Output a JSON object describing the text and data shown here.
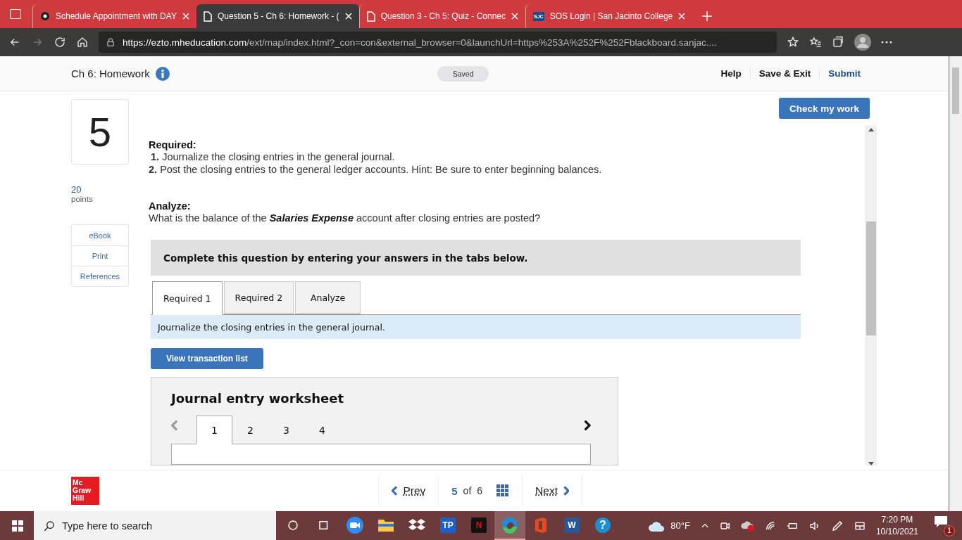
{
  "browser": {
    "tabs": [
      {
        "kind": "app",
        "label": "Schedule Appointment with DAY",
        "selected": false
      },
      {
        "kind": "doc",
        "label": "Question 5 - Ch 6: Homework - (",
        "selected": true
      },
      {
        "kind": "doc",
        "label": "Question 3 - Ch 5: Quiz - Connec",
        "selected": false
      },
      {
        "kind": "sjc",
        "badge": "SJC",
        "label": "SOS Login | San Jacinto College",
        "selected": false
      }
    ],
    "url_host": "https://ezto.mheducation.com",
    "url_path": "/ext/map/index.html?_con=con&external_browser=0&launchUrl=https%253A%252F%252Fblackboard.sanjac...."
  },
  "header": {
    "title": "Ch 6: Homework",
    "status": "Saved",
    "links": [
      "Help",
      "Save & Exit",
      "Submit"
    ]
  },
  "question": {
    "number": "5",
    "points": "20",
    "points_label": "points",
    "tools": [
      "eBook",
      "Print",
      "References"
    ]
  },
  "check_button": "Check my work",
  "required_heading": "Required:",
  "required_items": [
    {
      "num": "1.",
      "text": "Journalize the closing entries in the general journal."
    },
    {
      "num": "2.",
      "text": "Post the closing entries to the general ledger accounts. Hint: Be sure to enter beginning balances."
    }
  ],
  "analyze_heading": "Analyze:",
  "analyze_text": "What is the balance of the **Salaries Expense** account after closing entries are posted?",
  "instruction_banner": "Complete this question by entering your answers in the tabs below.",
  "answer_tabs": [
    {
      "label": "Required 1",
      "selected": true
    },
    {
      "label": "Required 2",
      "selected": false
    },
    {
      "label": "Analyze",
      "selected": false
    }
  ],
  "tab_instruction": "Journalize the closing entries in the general journal.",
  "view_button": "View transaction list",
  "worksheet": {
    "title": "Journal entry worksheet",
    "pages": [
      {
        "label": "1",
        "selected": true
      },
      {
        "label": "2",
        "selected": false
      },
      {
        "label": "3",
        "selected": false
      },
      {
        "label": "4",
        "selected": false
      }
    ]
  },
  "footer": {
    "logo": [
      "Mc",
      "Graw",
      "Hill"
    ],
    "prev": "Prev",
    "current": "5",
    "of": "of",
    "total": "6",
    "next": "Next"
  },
  "taskbar": {
    "search_placeholder": "Type here to search",
    "apps": [
      {
        "kind": "cortana",
        "selected": false
      },
      {
        "kind": "taskview",
        "selected": false
      },
      {
        "kind": "zoom",
        "selected": false
      },
      {
        "kind": "explorer",
        "selected": false
      },
      {
        "kind": "dropbox",
        "selected": false
      },
      {
        "kind": "tp",
        "label": "TP",
        "selected": false
      },
      {
        "kind": "netflix",
        "label": "N",
        "selected": false
      },
      {
        "kind": "edge",
        "selected": true
      },
      {
        "kind": "office",
        "selected": false
      },
      {
        "kind": "word",
        "label": "W",
        "selected": false
      },
      {
        "kind": "help",
        "label": "?",
        "selected": false
      }
    ],
    "temperature": "80°F",
    "time": "7:20 PM",
    "date": "10/10/2021",
    "notifications": "1"
  }
}
